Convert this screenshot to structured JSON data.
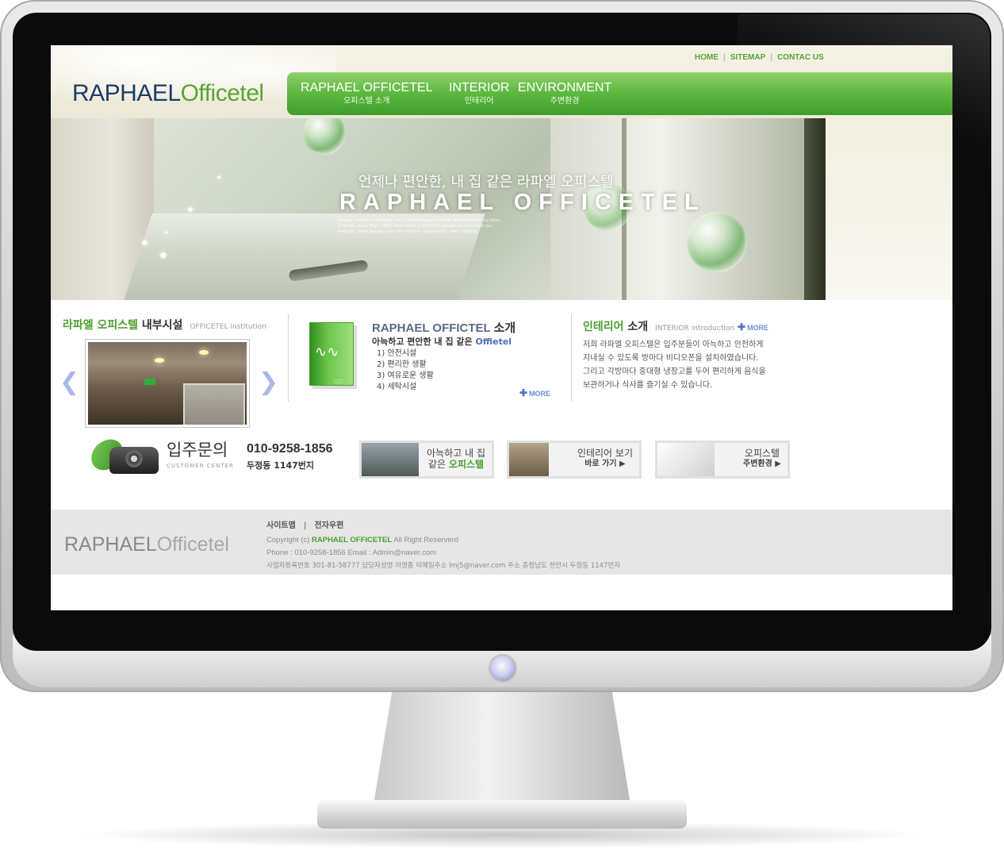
{
  "top_nav": {
    "items": [
      "HOME",
      "SITEMAP",
      "CONTAC US"
    ]
  },
  "logo": {
    "part1": "RAPHAEL",
    "part2": "Officetel"
  },
  "main_nav": [
    {
      "en": "RAPHAEL OFFICETEL",
      "ko": "오피스텔 소개"
    },
    {
      "en": "INTERIOR",
      "ko": "인테리어"
    },
    {
      "en": "ENVIRONMENT",
      "ko": "주변환경"
    }
  ],
  "hero": {
    "title_ko": "언제나 편안한, 내 집 같은 라파엘 오피스텔",
    "title_en": "RAPHAEL OFFICETEL",
    "small_text": "Asadal has been running one of the biggest domain and web hosting sites in Korea since May 1998. More than 3,000,000 people have visited our website, www.asadal.com, for domain registration, web hosting."
  },
  "facility": {
    "title_green": "라파엘 오피스텔",
    "title_dark": "내부시설",
    "title_sub": "OFFICETEL institution",
    "prev_icon": "chevron-left-icon",
    "next_icon": "chevron-right-icon"
  },
  "intro": {
    "title_en": "RAPHAEL OFFICTEL",
    "title_ko": "소개",
    "subtitle": "아늑하고 편안한 내 집 같은",
    "subtitle_accent": "Offietel",
    "list": [
      "1) 안전시설",
      "2) 편리한 생활",
      "3) 여유로운 생활",
      "4) 세탁시설"
    ],
    "more": "MORE"
  },
  "interior": {
    "title_green": "인테리어",
    "title_dark": "소개",
    "title_sub": "INTERIOR introduction",
    "more": "MORE",
    "lines": [
      "저희 라파엘 오피스텔은 입주분들이 아늑하고 안전하게",
      "지내실 수 있도록 방마다 비디오폰을 설치하였습니다.",
      "그리고 각방마다 중대형 냉장고를 두어 편리하게 음식을",
      "보관하거나 식사를 즐기실 수 있습니다."
    ]
  },
  "contact": {
    "title": "입주문의",
    "sub": "CUSTOMER CENTER",
    "phone": "010-9258-1856",
    "address": "두정동 1147번지"
  },
  "banners": [
    {
      "line1": "아늑하고 내 집",
      "line2_a": "같은 ",
      "line2_b": "오피스텔"
    },
    {
      "line1": "인테리어 보기",
      "line2": "바로 가기 ▶"
    },
    {
      "line1": "오피스텔",
      "line2": "주변환경 ▶"
    }
  ],
  "footer": {
    "logo_part1": "RAPHAEL",
    "logo_part2": "Officetel",
    "links": [
      "사이트맵",
      "전자우편"
    ],
    "copyright_prefix": "Copyright (c)",
    "copyright_brand": "RAPHAEL OFFICETEL",
    "copyright_suffix": "All Right Reserverd",
    "phone_line": "Phone : 010-9258-1856  Email : Admin@naver.com",
    "biz_line": "사업자등록번호 301-81-58777 담당자성명 이명종 이메일주소 lmj5@naver.com  주소 충청남도 천안시 두정동 1147번지"
  },
  "colors": {
    "accent_green": "#4a9e2b",
    "nav_green": "#58b43c",
    "logo_navy": "#1d3d68",
    "link_blue": "#6b8fd6"
  }
}
